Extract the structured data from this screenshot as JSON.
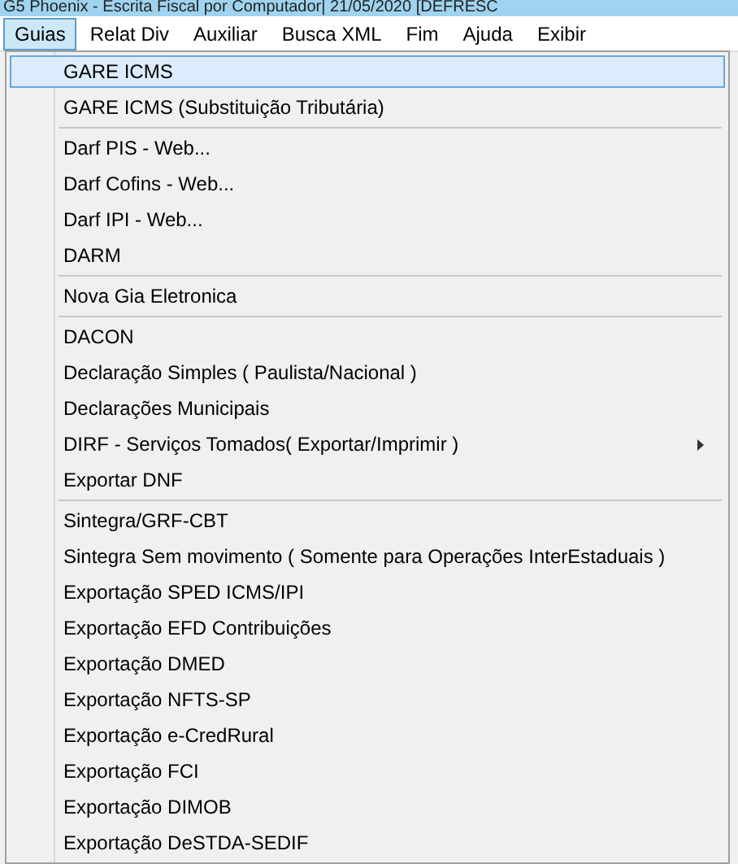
{
  "window": {
    "title": "G5 Phoenix - Escrita Fiscal por Computador| 21/05/2020 [DEFRESC"
  },
  "menubar": [
    {
      "label": "Guias",
      "selected": true
    },
    {
      "label": "Relat Div",
      "selected": false
    },
    {
      "label": "Auxiliar",
      "selected": false
    },
    {
      "label": "Busca XML",
      "selected": false
    },
    {
      "label": "Fim",
      "selected": false
    },
    {
      "label": "Ajuda",
      "selected": false
    },
    {
      "label": "Exibir",
      "selected": false
    }
  ],
  "menu": [
    {
      "kind": "item",
      "label": "GARE ICMS",
      "selected": true,
      "has_submenu": false
    },
    {
      "kind": "item",
      "label": "GARE ICMS (Substituição Tributária)",
      "selected": false,
      "has_submenu": false
    },
    {
      "kind": "separator"
    },
    {
      "kind": "item",
      "label": "Darf PIS - Web...",
      "selected": false,
      "has_submenu": false
    },
    {
      "kind": "item",
      "label": "Darf Cofins - Web...",
      "selected": false,
      "has_submenu": false
    },
    {
      "kind": "item",
      "label": "Darf IPI - Web...",
      "selected": false,
      "has_submenu": false
    },
    {
      "kind": "item",
      "label": "DARM",
      "selected": false,
      "has_submenu": false
    },
    {
      "kind": "separator"
    },
    {
      "kind": "item",
      "label": "Nova Gia Eletronica",
      "selected": false,
      "has_submenu": false
    },
    {
      "kind": "separator"
    },
    {
      "kind": "item",
      "label": "DACON",
      "selected": false,
      "has_submenu": false
    },
    {
      "kind": "item",
      "label": "Declaração Simples ( Paulista/Nacional )",
      "selected": false,
      "has_submenu": false
    },
    {
      "kind": "item",
      "label": "Declarações Municipais",
      "selected": false,
      "has_submenu": false
    },
    {
      "kind": "item",
      "label": "DIRF - Serviços Tomados( Exportar/Imprimir )",
      "selected": false,
      "has_submenu": true
    },
    {
      "kind": "item",
      "label": "Exportar DNF",
      "selected": false,
      "has_submenu": false
    },
    {
      "kind": "separator"
    },
    {
      "kind": "item",
      "label": "Sintegra/GRF-CBT",
      "selected": false,
      "has_submenu": false
    },
    {
      "kind": "item",
      "label": "Sintegra Sem movimento ( Somente para Operações InterEstaduais )",
      "selected": false,
      "has_submenu": false
    },
    {
      "kind": "item",
      "label": "Exportação SPED ICMS/IPI",
      "selected": false,
      "has_submenu": false
    },
    {
      "kind": "item",
      "label": "Exportação EFD Contribuições",
      "selected": false,
      "has_submenu": false
    },
    {
      "kind": "item",
      "label": "Exportação DMED",
      "selected": false,
      "has_submenu": false
    },
    {
      "kind": "item",
      "label": "Exportação NFTS-SP",
      "selected": false,
      "has_submenu": false
    },
    {
      "kind": "item",
      "label": "Exportação e-CredRural",
      "selected": false,
      "has_submenu": false
    },
    {
      "kind": "item",
      "label": "Exportação FCI",
      "selected": false,
      "has_submenu": false
    },
    {
      "kind": "item",
      "label": "Exportação DIMOB",
      "selected": false,
      "has_submenu": false
    },
    {
      "kind": "item",
      "label": "Exportação DeSTDA-SEDIF",
      "selected": false,
      "has_submenu": false
    }
  ]
}
